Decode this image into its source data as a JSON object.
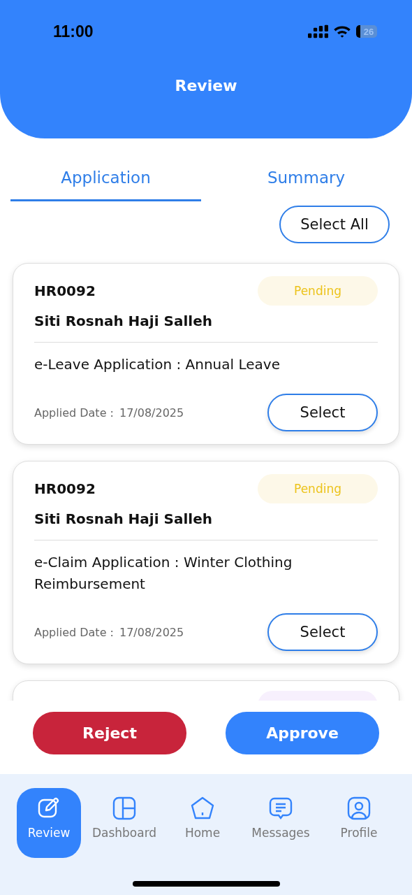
{
  "status_bar": {
    "time": "11:00",
    "battery": "26"
  },
  "header": {
    "title": "Review"
  },
  "tabs": [
    {
      "label": "Application",
      "selected": true
    },
    {
      "label": "Summary",
      "selected": false
    }
  ],
  "select_all_button": "Select All",
  "applications": [
    {
      "id": "HR0092",
      "status": "Pending",
      "color": "#fdf8e8",
      "name": "Siti Rosnah Haji Salleh",
      "type": "e-Leave Application : Annual Leave",
      "date_label": "Applied Date :",
      "date": "17/08/2025",
      "button": "Select"
    },
    {
      "id": "HR0092",
      "status": "Pending",
      "color": "#fdf8e8",
      "name": "Siti Rosnah Haji Salleh",
      "type": "e-Claim Application : Winter Clothing Reimbursement",
      "date_label": "Applied Date :",
      "date": "17/08/2025",
      "button": "Select"
    },
    {
      "color": "#f7f0fd"
    }
  ],
  "actions": [
    {
      "label": "Reject",
      "kind": "reject"
    },
    {
      "label": "Approve",
      "kind": "approve"
    }
  ],
  "nav": [
    {
      "label": "Review",
      "kind": "edit",
      "selected": true
    },
    {
      "label": "Dashboard",
      "kind": "grid",
      "selected": false
    },
    {
      "label": "Home",
      "kind": "home",
      "selected": false
    },
    {
      "label": "Messages",
      "kind": "chat",
      "selected": false
    },
    {
      "label": "Profile",
      "kind": "user",
      "selected": false
    }
  ]
}
